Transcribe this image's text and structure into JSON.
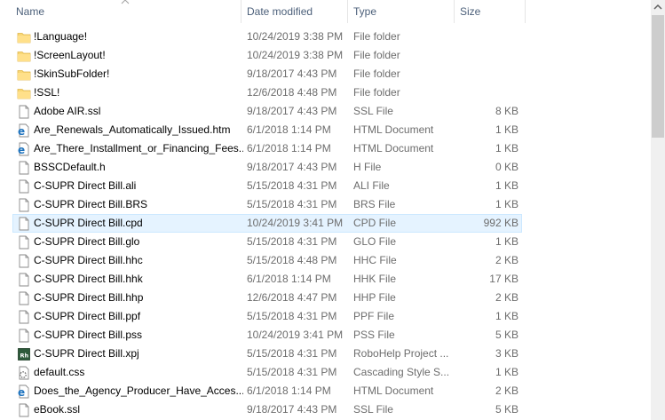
{
  "columns": {
    "name": "Name",
    "date": "Date modified",
    "type": "Type",
    "size": "Size"
  },
  "files": [
    {
      "name": "!Language!",
      "date": "10/24/2019 3:38 PM",
      "type": "File folder",
      "size": "",
      "icon": "folder-icon"
    },
    {
      "name": "!ScreenLayout!",
      "date": "10/24/2019 3:38 PM",
      "type": "File folder",
      "size": "",
      "icon": "folder-icon"
    },
    {
      "name": "!SkinSubFolder!",
      "date": "9/18/2017 4:43 PM",
      "type": "File folder",
      "size": "",
      "icon": "folder-icon"
    },
    {
      "name": "!SSL!",
      "date": "12/6/2018 4:48 PM",
      "type": "File folder",
      "size": "",
      "icon": "folder-icon"
    },
    {
      "name": "Adobe AIR.ssl",
      "date": "9/18/2017 4:43 PM",
      "type": "SSL File",
      "size": "8 KB",
      "icon": "file-icon"
    },
    {
      "name": "Are_Renewals_Automatically_Issued.htm",
      "date": "6/1/2018 1:14 PM",
      "type": "HTML Document",
      "size": "1 KB",
      "icon": "html-icon"
    },
    {
      "name": "Are_There_Installment_or_Financing_Fees...",
      "date": "6/1/2018 1:14 PM",
      "type": "HTML Document",
      "size": "1 KB",
      "icon": "html-icon"
    },
    {
      "name": "BSSCDefault.h",
      "date": "9/18/2017 4:43 PM",
      "type": "H File",
      "size": "0 KB",
      "icon": "file-icon"
    },
    {
      "name": "C-SUPR Direct Bill.ali",
      "date": "5/15/2018 4:31 PM",
      "type": "ALI File",
      "size": "1 KB",
      "icon": "file-icon"
    },
    {
      "name": "C-SUPR Direct Bill.BRS",
      "date": "5/15/2018 4:31 PM",
      "type": "BRS File",
      "size": "1 KB",
      "icon": "file-icon"
    },
    {
      "name": "C-SUPR Direct Bill.cpd",
      "date": "10/24/2019 3:41 PM",
      "type": "CPD File",
      "size": "992 KB",
      "icon": "file-icon",
      "selected": true
    },
    {
      "name": "C-SUPR Direct Bill.glo",
      "date": "5/15/2018 4:31 PM",
      "type": "GLO File",
      "size": "1 KB",
      "icon": "file-icon"
    },
    {
      "name": "C-SUPR Direct Bill.hhc",
      "date": "5/15/2018 4:48 PM",
      "type": "HHC File",
      "size": "2 KB",
      "icon": "file-icon"
    },
    {
      "name": "C-SUPR Direct Bill.hhk",
      "date": "6/1/2018 1:14 PM",
      "type": "HHK File",
      "size": "17 KB",
      "icon": "file-icon"
    },
    {
      "name": "C-SUPR Direct Bill.hhp",
      "date": "12/6/2018 4:47 PM",
      "type": "HHP File",
      "size": "2 KB",
      "icon": "file-icon"
    },
    {
      "name": "C-SUPR Direct Bill.ppf",
      "date": "5/15/2018 4:31 PM",
      "type": "PPF File",
      "size": "1 KB",
      "icon": "file-icon"
    },
    {
      "name": "C-SUPR Direct Bill.pss",
      "date": "10/24/2019 3:41 PM",
      "type": "PSS File",
      "size": "5 KB",
      "icon": "file-icon"
    },
    {
      "name": "C-SUPR Direct Bill.xpj",
      "date": "5/15/2018 4:31 PM",
      "type": "RoboHelp Project ...",
      "size": "3 KB",
      "icon": "robohelp-icon"
    },
    {
      "name": "default.css",
      "date": "5/15/2018 4:31 PM",
      "type": "Cascading Style S...",
      "size": "1 KB",
      "icon": "css-icon"
    },
    {
      "name": "Does_the_Agency_Producer_Have_Acces...",
      "date": "6/1/2018 1:14 PM",
      "type": "HTML Document",
      "size": "2 KB",
      "icon": "html-icon"
    },
    {
      "name": "eBook.ssl",
      "date": "9/18/2017 4:43 PM",
      "type": "SSL File",
      "size": "5 KB",
      "icon": "file-icon"
    }
  ],
  "colors": {
    "header_text": "#4c607a",
    "detail_text": "#6d6d6d",
    "selection_bg": "#e5f3ff",
    "selection_border": "#cce8ff",
    "folder": "#f8d775",
    "ie_blue": "#1e73be"
  }
}
